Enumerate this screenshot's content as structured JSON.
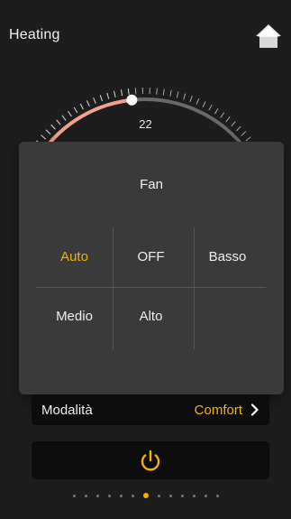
{
  "header": {
    "title": "Heating",
    "home_icon": "home-icon"
  },
  "dial": {
    "setpoint": "22",
    "active_color": "#f2a090",
    "track_color": "#6a6a6a"
  },
  "fan_modal": {
    "title": "Fan",
    "options": [
      "Auto",
      "OFF",
      "Basso",
      "Medio",
      "Alto"
    ],
    "selected": "Auto"
  },
  "mode": {
    "label": "Modalità",
    "value": "Comfort",
    "chevron_icon": "chevron-right-icon"
  },
  "power": {
    "icon": "power-icon"
  },
  "pager": {
    "count": 13,
    "active_index": 6
  },
  "colors": {
    "accent": "#f5b200",
    "background": "#1d1d1d",
    "panel": "#3a3a3a"
  }
}
